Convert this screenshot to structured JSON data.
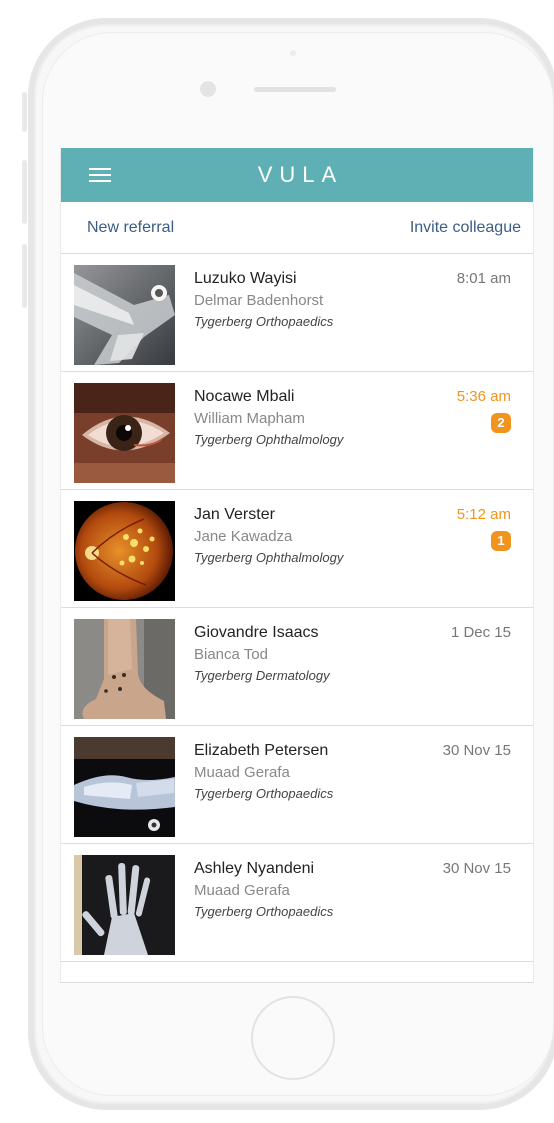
{
  "app": {
    "title": "VULA"
  },
  "actions": {
    "new_referral": "New referral",
    "invite_colleague": "Invite colleague"
  },
  "colors": {
    "header": "#5fb0b4",
    "link": "#3b5d86",
    "unread": "#f0941e"
  },
  "referrals": [
    {
      "patient": "Luzuko Wayisi",
      "doctor": "Delmar Badenhorst",
      "department": "Tygerberg Orthopaedics",
      "time": "8:01 am",
      "unread_count": null,
      "thumbnail": "xray-leg"
    },
    {
      "patient": "Nocawe Mbali",
      "doctor": "William Mapham",
      "department": "Tygerberg Ophthalmology",
      "time": "5:36 am",
      "unread_count": "2",
      "thumbnail": "eye-photo"
    },
    {
      "patient": "Jan Verster",
      "doctor": "Jane Kawadza",
      "department": "Tygerberg Ophthalmology",
      "time": "5:12 am",
      "unread_count": "1",
      "thumbnail": "retina-photo"
    },
    {
      "patient": "Giovandre Isaacs",
      "doctor": "Bianca Tod",
      "department": "Tygerberg Dermatology",
      "time": "1 Dec 15",
      "unread_count": null,
      "thumbnail": "ankle-photo"
    },
    {
      "patient": "Elizabeth Petersen",
      "doctor": "Muaad Gerafa",
      "department": "Tygerberg Orthopaedics",
      "time": "30 Nov 15",
      "unread_count": null,
      "thumbnail": "xray-foot"
    },
    {
      "patient": "Ashley Nyandeni",
      "doctor": "Muaad Gerafa",
      "department": "Tygerberg Orthopaedics",
      "time": "30 Nov 15",
      "unread_count": null,
      "thumbnail": "xray-hand"
    }
  ]
}
